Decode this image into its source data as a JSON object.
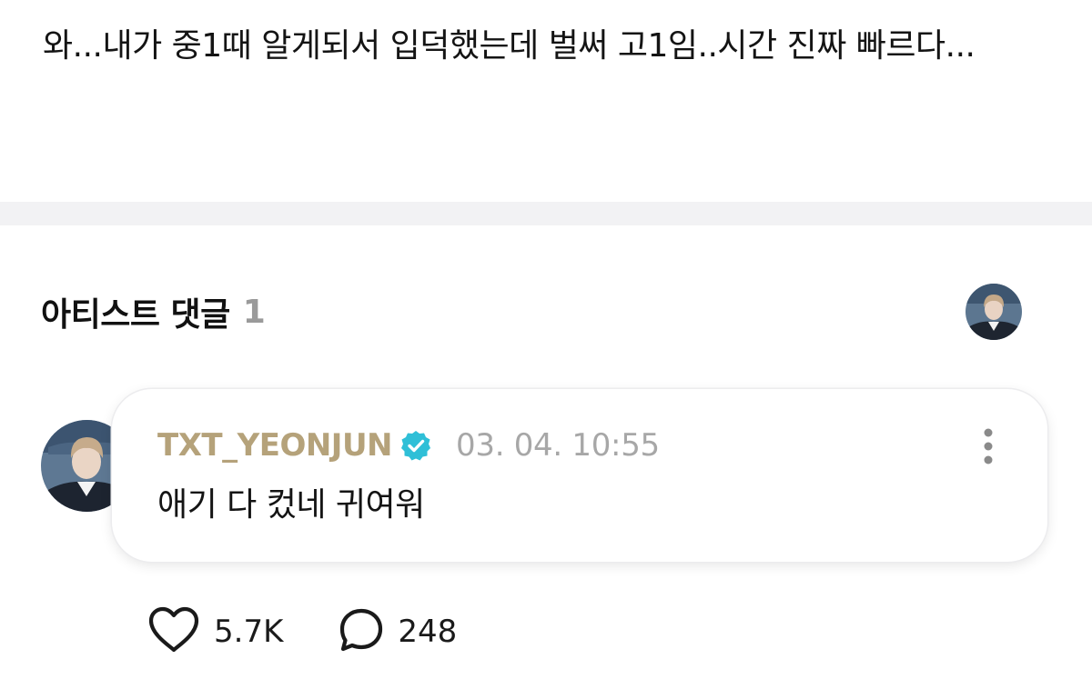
{
  "post": {
    "body": "와...내가 중1때 알게되서 입덕했는데 벌써 고1임..시간 진짜 빠르다..."
  },
  "artist_comments": {
    "title": "아티스트 댓글",
    "count": "1",
    "header_avatar_icon": "artist-profile-avatar"
  },
  "comment": {
    "author": "TXT_YEONJUN",
    "verified_icon": "verified-badge-icon",
    "timestamp": "03. 04. 10:55",
    "text": "애기 다 컸네 귀여워",
    "more_icon": "more-vertical-icon",
    "likes": "5.7K",
    "replies": "248"
  },
  "colors": {
    "author": "#b5a27a",
    "verified": "#2fbfd7",
    "muted": "#a7a7a7",
    "divider": "#f2f2f4"
  }
}
